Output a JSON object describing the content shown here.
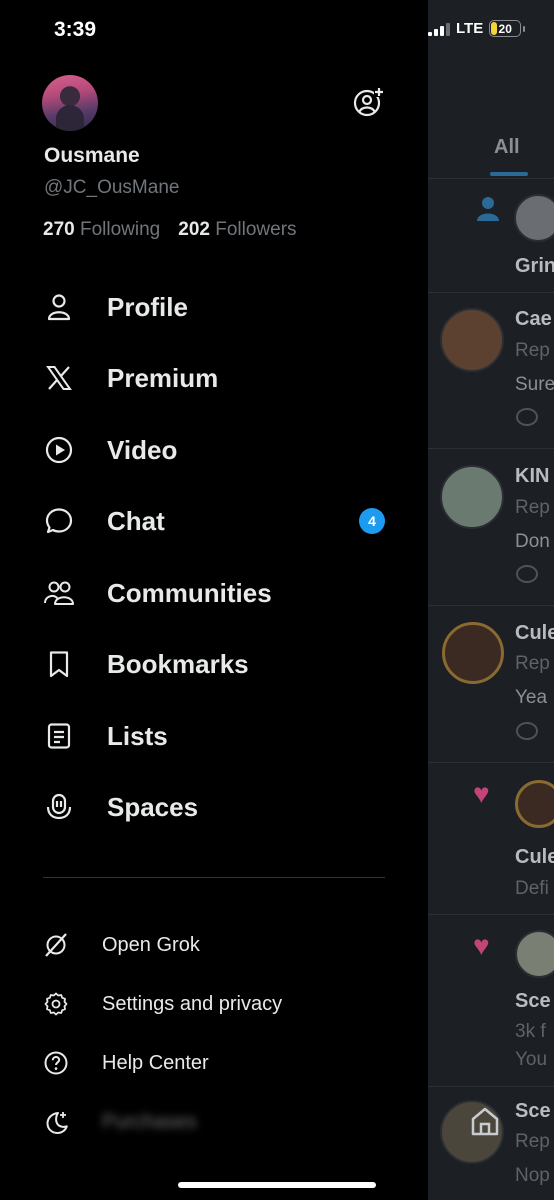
{
  "status_bar": {
    "time": "3:39",
    "network": "LTE",
    "battery": "20"
  },
  "profile": {
    "display_name": "Ousmane",
    "handle": "@JC_OusMane",
    "following_count": "270",
    "following_label": "Following",
    "followers_count": "202",
    "followers_label": "Followers"
  },
  "nav": {
    "items": [
      {
        "label": "Profile",
        "icon": "person-icon"
      },
      {
        "label": "Premium",
        "icon": "x-logo-icon"
      },
      {
        "label": "Video",
        "icon": "play-circle-icon"
      },
      {
        "label": "Chat",
        "icon": "chat-bubble-icon",
        "badge": "4"
      },
      {
        "label": "Communities",
        "icon": "people-icon"
      },
      {
        "label": "Bookmarks",
        "icon": "bookmark-icon"
      },
      {
        "label": "Lists",
        "icon": "list-icon"
      },
      {
        "label": "Spaces",
        "icon": "microphone-icon"
      }
    ]
  },
  "secondary": {
    "items": [
      {
        "label": "Open Grok",
        "icon": "grok-icon"
      },
      {
        "label": "Settings and privacy",
        "icon": "gear-icon"
      },
      {
        "label": "Help Center",
        "icon": "help-circle-icon"
      },
      {
        "label": "Purchases",
        "icon": "moon-icon"
      }
    ]
  },
  "background": {
    "tab": "All",
    "rows": [
      {
        "name": "Grin"
      },
      {
        "name": "Cae",
        "meta": "Rep",
        "text": "Sure"
      },
      {
        "name": "KIN",
        "meta": "Rep",
        "text": "Don"
      },
      {
        "name": "Cule",
        "meta": "Rep",
        "text": "Yea"
      },
      {
        "name": "Cule",
        "text": "Defi"
      },
      {
        "name": "Sce",
        "meta": "3k f",
        "text": "You"
      },
      {
        "name": "Sce",
        "meta": "Rep",
        "text": "Nop"
      }
    ]
  },
  "colors": {
    "accent": "#1d9bf0",
    "background": "#000000",
    "text": "#e7e9ea",
    "muted": "#71767b"
  }
}
